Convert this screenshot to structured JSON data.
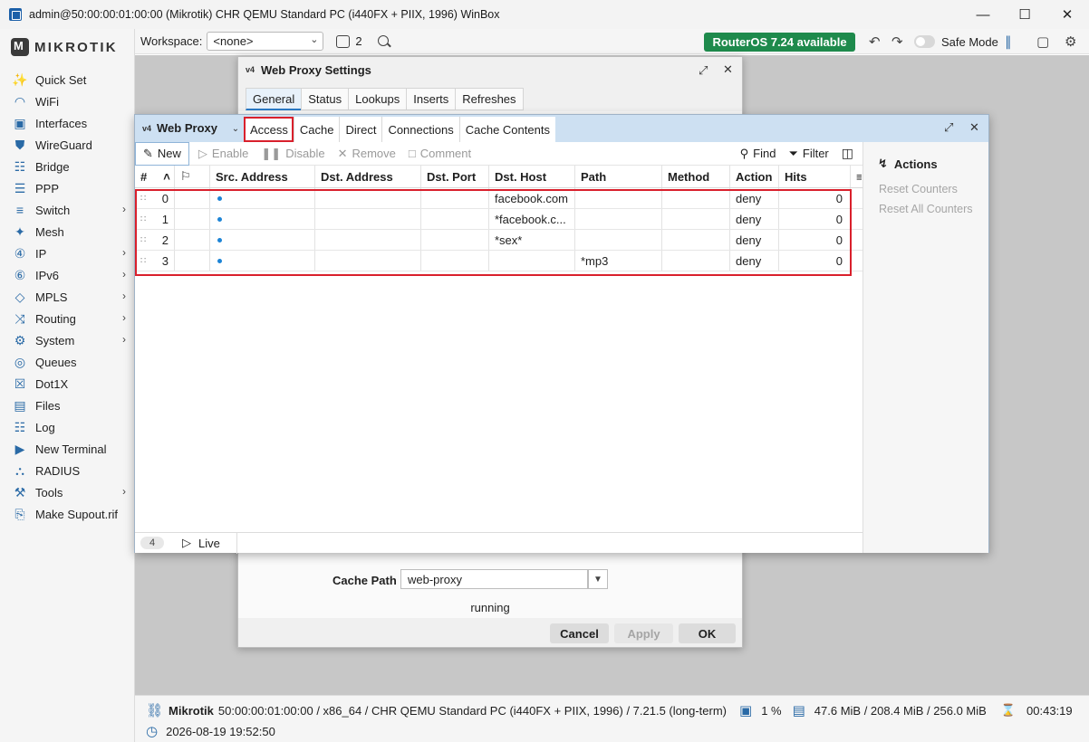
{
  "window": {
    "title": "admin@50:00:00:01:00:00 (Mikrotik) CHR QEMU Standard PC (i440FX + PIIX, 1996) WinBox"
  },
  "brand": {
    "logo_text": "MIKROTIK"
  },
  "sidebar": {
    "items": [
      {
        "label": "Quick Set",
        "icon": "wand-icon",
        "glyph": "✨",
        "submenu": false
      },
      {
        "label": "WiFi",
        "icon": "wifi-icon",
        "glyph": "◠",
        "submenu": false
      },
      {
        "label": "Interfaces",
        "icon": "interfaces-icon",
        "glyph": "▣",
        "submenu": false
      },
      {
        "label": "WireGuard",
        "icon": "wireguard-icon",
        "glyph": "⛊",
        "submenu": false
      },
      {
        "label": "Bridge",
        "icon": "bridge-icon",
        "glyph": "☷",
        "submenu": false
      },
      {
        "label": "PPP",
        "icon": "ppp-icon",
        "glyph": "☰",
        "submenu": false
      },
      {
        "label": "Switch",
        "icon": "switch-icon",
        "glyph": "≡",
        "submenu": true
      },
      {
        "label": "Mesh",
        "icon": "mesh-icon",
        "glyph": "✦",
        "submenu": false
      },
      {
        "label": "IP",
        "icon": "ip-icon",
        "glyph": "④",
        "submenu": true
      },
      {
        "label": "IPv6",
        "icon": "ipv6-icon",
        "glyph": "⑥",
        "submenu": true
      },
      {
        "label": "MPLS",
        "icon": "mpls-icon",
        "glyph": "◇",
        "submenu": true
      },
      {
        "label": "Routing",
        "icon": "routing-icon",
        "glyph": "⤨",
        "submenu": true
      },
      {
        "label": "System",
        "icon": "system-gear-icon",
        "glyph": "⚙",
        "submenu": true
      },
      {
        "label": "Queues",
        "icon": "queues-icon",
        "glyph": "◎",
        "submenu": false
      },
      {
        "label": "Dot1X",
        "icon": "dot1x-icon",
        "glyph": "☒",
        "submenu": false
      },
      {
        "label": "Files",
        "icon": "files-icon",
        "glyph": "▤",
        "submenu": false
      },
      {
        "label": "Log",
        "icon": "log-icon",
        "glyph": "☷",
        "submenu": false
      },
      {
        "label": "New Terminal",
        "icon": "terminal-icon",
        "glyph": "▶",
        "submenu": false
      },
      {
        "label": "RADIUS",
        "icon": "radius-icon",
        "glyph": "⛬",
        "submenu": false
      },
      {
        "label": "Tools",
        "icon": "tools-icon",
        "glyph": "⚒",
        "submenu": true
      },
      {
        "label": "Make Supout.rif",
        "icon": "supout-icon",
        "glyph": "⎘",
        "submenu": false
      }
    ]
  },
  "toolbar": {
    "workspace_label": "Workspace:",
    "workspace_value": "<none>",
    "window_count": "2",
    "update_badge": "RouterOS 7.24 available",
    "safe_mode_label": "Safe Mode"
  },
  "settings_window": {
    "title": "Web Proxy Settings",
    "tabs": [
      "General",
      "Status",
      "Lookups",
      "Inserts",
      "Refreshes"
    ],
    "cache_path_label": "Cache Path",
    "cache_path_value": "web-proxy",
    "status": "running",
    "buttons": {
      "cancel": "Cancel",
      "apply": "Apply",
      "ok": "OK"
    }
  },
  "proxy_window": {
    "title": "Web Proxy",
    "tabs": [
      "Access",
      "Cache",
      "Direct",
      "Connections",
      "Cache Contents"
    ],
    "actions": {
      "new": "New",
      "enable": "Enable",
      "disable": "Disable",
      "remove": "Remove",
      "comment": "Comment",
      "find": "Find",
      "filter": "Filter"
    },
    "columns": [
      "#",
      "Src. Address",
      "Dst. Address",
      "Dst. Port",
      "Dst. Host",
      "Path",
      "Method",
      "Action",
      "Hits"
    ],
    "rows": [
      {
        "num": "0",
        "src": "",
        "dst": "",
        "port": "",
        "host": "facebook.com",
        "path": "",
        "method": "",
        "action": "deny",
        "hits": "0"
      },
      {
        "num": "1",
        "src": "",
        "dst": "",
        "port": "",
        "host": "*facebook.c...",
        "path": "",
        "method": "",
        "action": "deny",
        "hits": "0"
      },
      {
        "num": "2",
        "src": "",
        "dst": "",
        "port": "",
        "host": "*sex*",
        "path": "",
        "method": "",
        "action": "deny",
        "hits": "0"
      },
      {
        "num": "3",
        "src": "",
        "dst": "",
        "port": "",
        "host": "",
        "path": "*mp3",
        "method": "",
        "action": "deny",
        "hits": "0"
      }
    ],
    "footer": {
      "count": "4",
      "live": "Live"
    },
    "side_panel": {
      "title": "Actions",
      "items": [
        "Reset Counters",
        "Reset All Counters"
      ]
    }
  },
  "statusbar": {
    "device_name": "Mikrotik",
    "device_info": "50:00:00:01:00:00 / x86_64 / CHR QEMU Standard PC (i440FX + PIIX, 1996) / 7.21.5 (long-term)",
    "cpu": "1 %",
    "memory": "47.6 MiB / 208.4 MiB / 256.0 MiB",
    "uptime": "00:43:19",
    "datetime": "2026-08-19 19:52:50"
  },
  "colors": {
    "accent": "#2a7ac6",
    "badge_green": "#1e8a4c",
    "highlight_red": "#d9202c",
    "header_blue": "#cde0f2"
  }
}
